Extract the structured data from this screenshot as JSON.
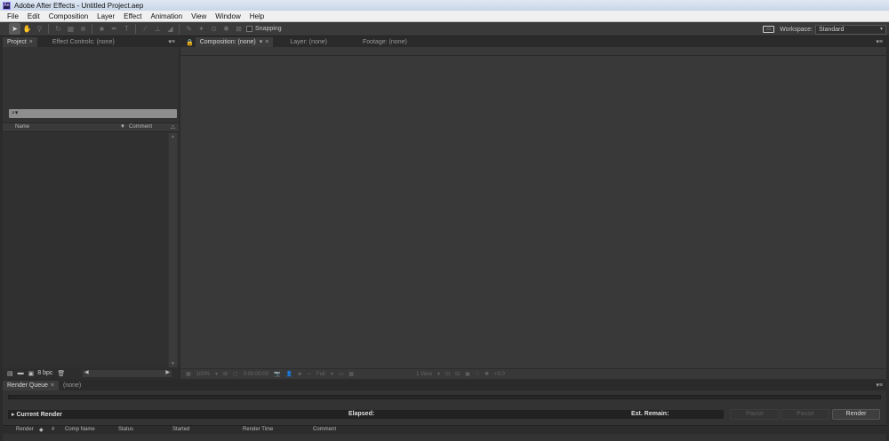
{
  "window": {
    "title": "Adobe After Effects - Untitled Project.aep",
    "app_icon": "Ae"
  },
  "menu": [
    "File",
    "Edit",
    "Composition",
    "Layer",
    "Effect",
    "Animation",
    "View",
    "Window",
    "Help"
  ],
  "toolbar": {
    "snapping_label": "Snapping",
    "workspace_label": "Workspace:",
    "workspace_value": "Standard"
  },
  "project_panel": {
    "tabs": [
      "Project",
      "Effect Controls: (none)"
    ],
    "columns": {
      "name": "Name",
      "comment": "Comment"
    },
    "bpc": "8 bpc"
  },
  "comp_panel": {
    "tabs": [
      "Composition: (none)",
      "Layer: (none)",
      "Footage: (none)"
    ],
    "footer": {
      "zoom": "100%",
      "timecode": "0:00:00:00",
      "resolution": "Full",
      "views": "1 View",
      "exposure": "+0.0"
    }
  },
  "render_queue": {
    "tabs": [
      "Render Queue",
      "(none)"
    ],
    "current_render": "Current Render",
    "elapsed": "Elapsed:",
    "est_remain": "Est. Remain:",
    "stop_label": "Pause",
    "pause_label": "Pause",
    "render_label": "Render",
    "columns": [
      "Render",
      "#",
      "Comp Name",
      "Status",
      "Started",
      "Render Time",
      "Comment"
    ]
  },
  "colors": {
    "panel": "#333333",
    "background": "#2b2b2b",
    "titlebar": "#dfe8f4",
    "menubar": "#f0f0f0"
  }
}
